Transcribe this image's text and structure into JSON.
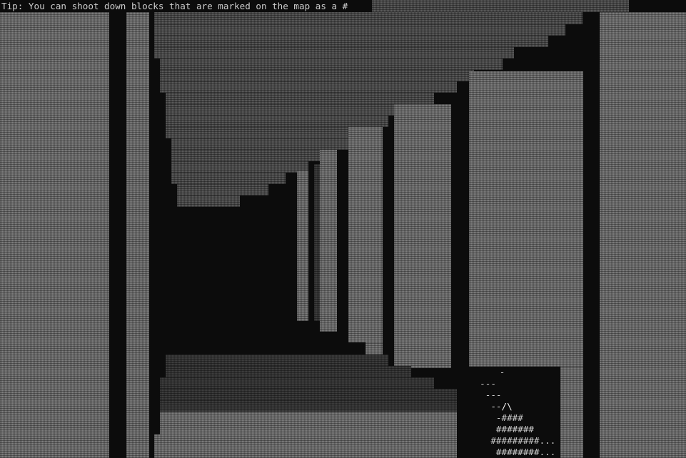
{
  "hud": {
    "tip": "Tip: You can shoot down blocks that are marked on the map as a #"
  },
  "minimap": {
    "rows": [
      "   -",
      "  ---",
      "   ---",
      "    --/\\",
      "     -####",
      "     #######",
      "    #########...",
      "     ########..."
    ]
  },
  "colors": {
    "background": "#0c0c0c",
    "wall_light": "#7c7c7c",
    "wall_mid": "#5a5a5a",
    "wall_dark": "#3e3e3e",
    "text": "#cccccc"
  }
}
